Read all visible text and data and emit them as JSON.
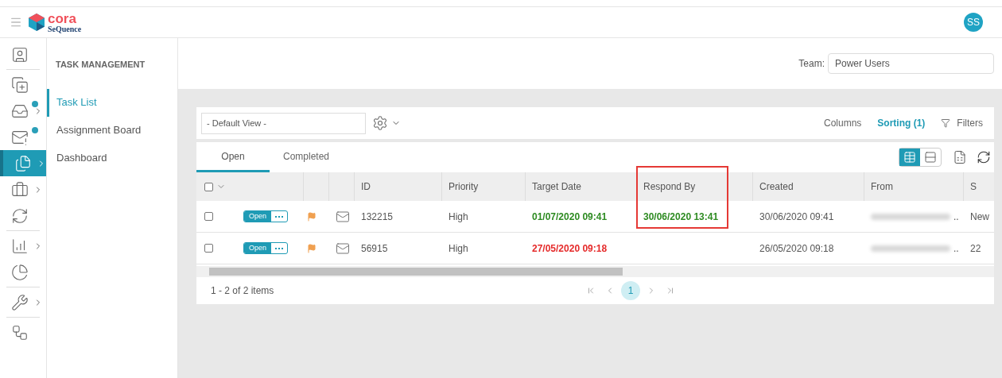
{
  "header": {
    "brand": "cora",
    "brand_sub": "SeQuence",
    "avatar": "SS"
  },
  "rail": [
    {
      "kind": "profile",
      "selected": false,
      "dot": false,
      "chevron": false,
      "divider": true
    },
    {
      "kind": "new",
      "selected": false,
      "dot": false,
      "chevron": false,
      "divider": false
    },
    {
      "kind": "inbox",
      "selected": false,
      "dot": true,
      "chevron": true,
      "divider": false
    },
    {
      "kind": "mail-alert",
      "selected": false,
      "dot": true,
      "chevron": false,
      "divider": false
    },
    {
      "kind": "tasks",
      "selected": true,
      "dot": false,
      "chevron": true,
      "divider": false
    },
    {
      "kind": "briefcase",
      "selected": false,
      "dot": false,
      "chevron": true,
      "divider": false
    },
    {
      "kind": "cycle",
      "selected": false,
      "dot": false,
      "chevron": false,
      "divider": true
    },
    {
      "kind": "analytics",
      "selected": false,
      "dot": false,
      "chevron": true,
      "divider": false
    },
    {
      "kind": "pie",
      "selected": false,
      "dot": false,
      "chevron": false,
      "divider": true
    },
    {
      "kind": "tools",
      "selected": false,
      "dot": false,
      "chevron": true,
      "divider": true
    },
    {
      "kind": "workflow",
      "selected": false,
      "dot": false,
      "chevron": false,
      "divider": false
    }
  ],
  "sidebar": {
    "title": "TASK MANAGEMENT",
    "items": [
      {
        "label": "Task List",
        "selected": true
      },
      {
        "label": "Assignment Board",
        "selected": false
      },
      {
        "label": "Dashboard",
        "selected": false
      }
    ]
  },
  "team": {
    "label": "Team:",
    "value": "Power Users"
  },
  "toolbar": {
    "view": "- Default View -",
    "columns": "Columns",
    "sorting": "Sorting (1)",
    "filters": "Filters"
  },
  "tabs": [
    {
      "label": "Open",
      "selected": true
    },
    {
      "label": "Completed",
      "selected": false
    }
  ],
  "view_modes": [
    {
      "kind": "grid",
      "selected": true
    },
    {
      "kind": "list",
      "selected": false
    }
  ],
  "table": {
    "select_all": {
      "checked": false
    },
    "columns": [
      {
        "label": "ID",
        "highlighted": false
      },
      {
        "label": "Priority",
        "highlighted": false
      },
      {
        "label": "Target Date",
        "highlighted": false
      },
      {
        "label": "Respond By",
        "highlighted": true
      },
      {
        "label": "Created",
        "highlighted": false
      },
      {
        "label": "From",
        "highlighted": false
      },
      {
        "label": "S",
        "highlighted": false
      }
    ],
    "rows": [
      {
        "checked": false,
        "status": "Open",
        "flagged": true,
        "cells": [
          {
            "text": "132215"
          },
          {
            "text": "High"
          },
          {
            "text": "01/07/2020 09:41",
            "color": "#2e8b22"
          },
          {
            "text": "30/06/2020 13:41",
            "color": "#2e8b22"
          },
          {
            "text": "30/06/2020 09:41"
          },
          {
            "text": "..",
            "redacted": true
          },
          {
            "text": "New"
          }
        ]
      },
      {
        "checked": false,
        "status": "Open",
        "flagged": true,
        "cells": [
          {
            "text": "56915"
          },
          {
            "text": "High"
          },
          {
            "text": "27/05/2020 09:18",
            "color": "#e52b2b"
          },
          null,
          {
            "text": "26/05/2020 09:18"
          },
          {
            "text": "..",
            "redacted": true
          },
          {
            "text": "22"
          }
        ]
      }
    ]
  },
  "pager": {
    "summary": "1 - 2 of 2 items",
    "pages": [
      {
        "label": "1",
        "selected": true
      }
    ]
  }
}
